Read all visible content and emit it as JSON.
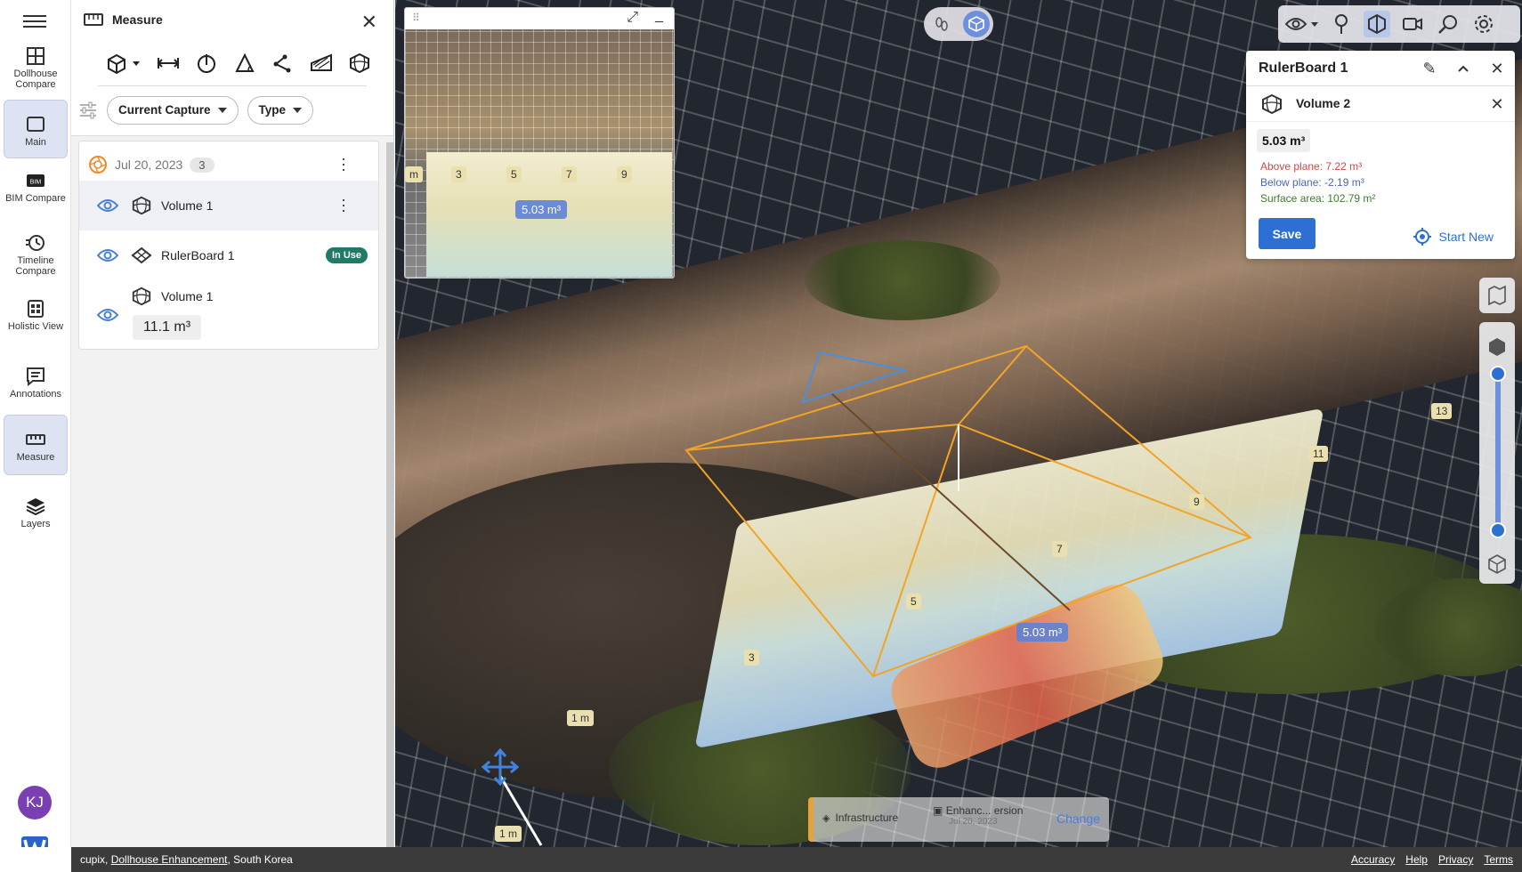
{
  "rail": {
    "items": [
      {
        "label": "Dollhouse Compare"
      },
      {
        "label": "Main"
      },
      {
        "label": "BIM Compare"
      },
      {
        "label": "Timeline Compare"
      },
      {
        "label": "Holistic View"
      },
      {
        "label": "Annotations"
      },
      {
        "label": "Measure"
      },
      {
        "label": "Layers"
      }
    ],
    "avatar": "KJ",
    "active": [
      "Main",
      "Measure"
    ]
  },
  "panel": {
    "title": "Measure",
    "filters": {
      "capture": "Current Capture",
      "type": "Type"
    },
    "date": "Jul 20, 2023",
    "count": "3",
    "items": [
      {
        "label": "Volume 1",
        "icon": "volume-icon"
      },
      {
        "label": "RulerBoard 1",
        "icon": "rulerboard-icon",
        "badge": "In Use"
      },
      {
        "label": "Volume 1",
        "icon": "volume-icon",
        "value": "11.1 m³"
      }
    ]
  },
  "viewport": {
    "minimap_label": "5.03 m³",
    "minimap_ticks": [
      "m",
      "3",
      "5",
      "7",
      "9"
    ],
    "main_label": "5.03 m³",
    "tags": [
      "3",
      "5",
      "7",
      "9",
      "11",
      "13"
    ],
    "scale_label": "1 m",
    "scale_label_2": "1 m",
    "bottom_info": {
      "layer": "Infrastructure",
      "version": "Enhanc... ersion",
      "date": "Jul 20, 2023",
      "change": "Change"
    }
  },
  "rulerboard": {
    "title": "RulerBoard 1",
    "volume_name": "Volume 2",
    "total": "5.03 m³",
    "above": "Above plane: 7.22 m³",
    "below": "Below plane: -2.19 m³",
    "surface": "Surface area: 102.79 m²",
    "save": "Save",
    "start_new": "Start New",
    "colors": {
      "above": "#d64545",
      "below": "#4a63c9",
      "surface": "#3c7d2a"
    }
  },
  "status": {
    "org": "cupix,",
    "project": "Dollhouse Enhancement",
    "location": ", South Korea",
    "links": [
      "Accuracy",
      "Help",
      "Privacy",
      "Terms"
    ]
  }
}
